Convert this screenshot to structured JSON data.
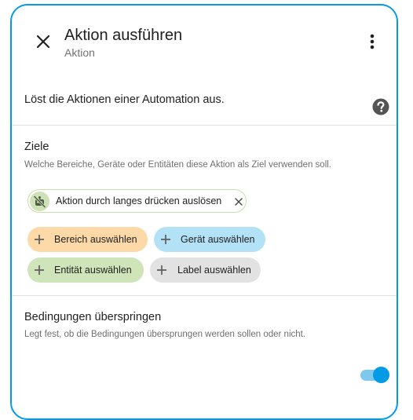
{
  "dialog": {
    "title": "Aktion ausführen",
    "subtitle": "Aktion",
    "description": "Löst die Aktionen einer Automation aus."
  },
  "targets": {
    "title": "Ziele",
    "description": "Welche Bereiche, Geräte oder Entitäten diese Aktion als Ziel verwenden soll.",
    "selected_entity": {
      "label": "Aktion durch langes drücken auslösen",
      "icon": "robot-off-icon"
    },
    "add_buttons": {
      "area": "Bereich auswählen",
      "device": "Gerät auswählen",
      "entity": "Entität auswählen",
      "label": "Label auswählen"
    }
  },
  "skip_conditions": {
    "title": "Bedingungen überspringen",
    "description": "Legt fest, ob die Bedingungen übersprungen werden sollen oder nicht.",
    "enabled": true
  },
  "colors": {
    "accent": "#039be5",
    "area_chip": "#fdd9a8",
    "device_chip": "#b3e2f7",
    "entity_chip": "#cfe4b9",
    "label_chip": "#e2e2e2"
  }
}
